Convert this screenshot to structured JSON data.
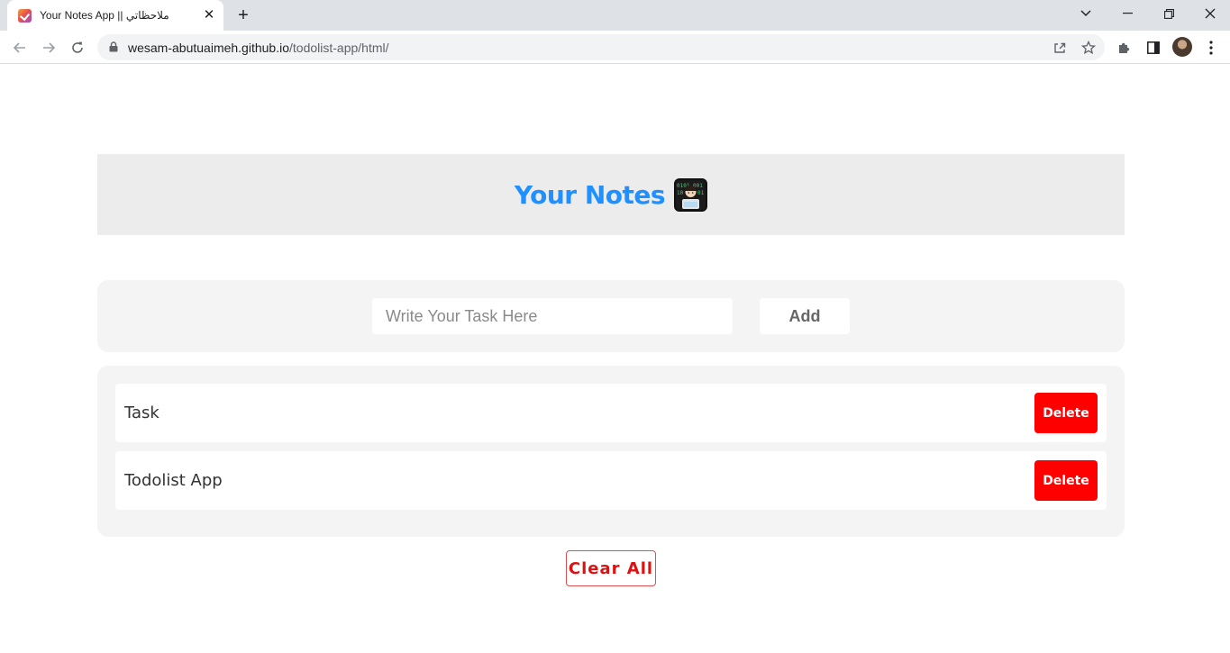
{
  "browser": {
    "tab_title": "Your Notes App || ملاحظاتي",
    "tab_close": "✕",
    "new_tab": "+",
    "url_host": "wesam-abutuaimeh.github.io",
    "url_path": "/todolist-app/html/"
  },
  "header": {
    "title": "Your Notes",
    "emoji": "technologist-emoji"
  },
  "form": {
    "input_placeholder": "Write Your Task Here",
    "input_value": "",
    "add_label": "Add"
  },
  "tasks": [
    {
      "text": "Task",
      "delete_label": "Delete"
    },
    {
      "text": "Todolist App",
      "delete_label": "Delete"
    }
  ],
  "clear_all_label": "Clear All",
  "colors": {
    "title": "#1e90ff",
    "delete_bg": "#ff0000",
    "clear_text": "#dd1111"
  }
}
